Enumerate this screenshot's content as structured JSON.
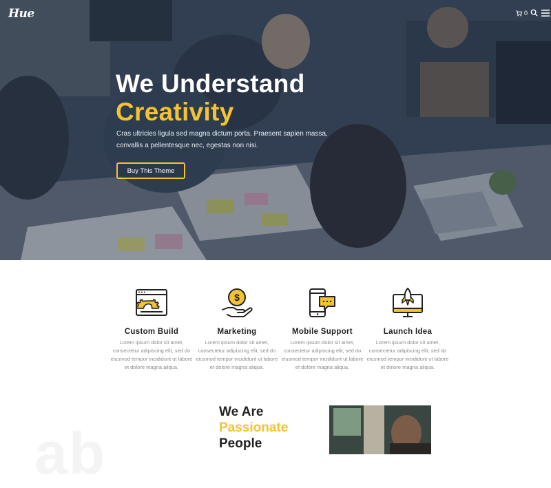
{
  "header": {
    "logo": "Hue",
    "cart_count": "0"
  },
  "hero": {
    "title_line1": "We Understand",
    "title_line2": "Creativity",
    "description": "Cras ultricies ligula sed magna dictum porta. Praesent sapien massa, convallis a pellentesque nec, egestas non nisi.",
    "button_label": "Buy This Theme"
  },
  "features": [
    {
      "title": "Custom Build",
      "icon": "browser-gear-icon",
      "text": "Lorem ipsum dolor sit amet, consectetur adipiscing elit, sed do eiusmod tempor incididunt ut labore et dolore magna aliqua."
    },
    {
      "title": "Marketing",
      "icon": "hand-coin-icon",
      "text": "Lorem ipsum dolor sit amet, consectetur adipiscing elit, sed do eiusmod tempor incididunt ut labore et dolore magna aliqua."
    },
    {
      "title": "Mobile Support",
      "icon": "mobile-chat-icon",
      "text": "Lorem ipsum dolor sit amet, consectetur adipiscing elit, sed do eiusmod tempor incididunt ut labore et dolore magna aliqua."
    },
    {
      "title": "Launch Idea",
      "icon": "monitor-rocket-icon",
      "text": "Lorem ipsum dolor sit amet, consectetur adipiscing elit, sed do eiusmod tempor incididunt ut labore et dolore magna aliqua."
    }
  ],
  "about": {
    "line1": "We Are",
    "line2": "Passionate",
    "line3": "People",
    "ghost_text": "ab"
  },
  "colors": {
    "accent": "#f3c332",
    "dark_text": "#222222",
    "muted_text": "#8b8b8b"
  }
}
